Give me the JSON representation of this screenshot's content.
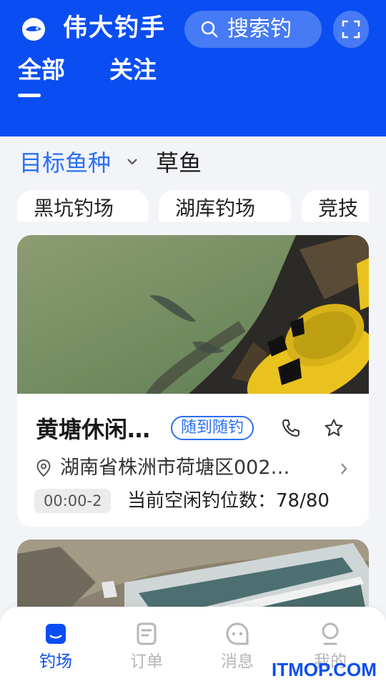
{
  "header": {
    "title": "伟大钓手",
    "search_placeholder": "搜索钓",
    "tabs": [
      {
        "label": "全部",
        "active": true
      },
      {
        "label": "关注",
        "active": false
      }
    ],
    "brand_color": "#0a4ef2"
  },
  "filter": {
    "label": "目标鱼种",
    "value": "草鱼",
    "chips": [
      "黑坑钓场",
      "湖库钓场",
      "竞技"
    ]
  },
  "venues": [
    {
      "name": "黄塘休闲…",
      "badge": "随到随钓",
      "address": "湖南省株洲市荷塘区002…",
      "hours": "00:00-2",
      "seats_label": "当前空闲钓位数：78/80"
    }
  ],
  "bottom_nav": [
    {
      "label": "钓场",
      "icon": "fishing-spot-icon",
      "active": true
    },
    {
      "label": "订单",
      "icon": "order-icon",
      "active": false
    },
    {
      "label": "消息",
      "icon": "message-icon",
      "active": false
    },
    {
      "label": "我的",
      "icon": "profile-icon",
      "active": false
    }
  ],
  "watermark": "ITMOP.COM",
  "colors": {
    "accent": "#2b6ff5",
    "nav_inactive": "#b6b6b6",
    "card_bg": "#ffffff",
    "page_bg": "#f2f4f8"
  }
}
